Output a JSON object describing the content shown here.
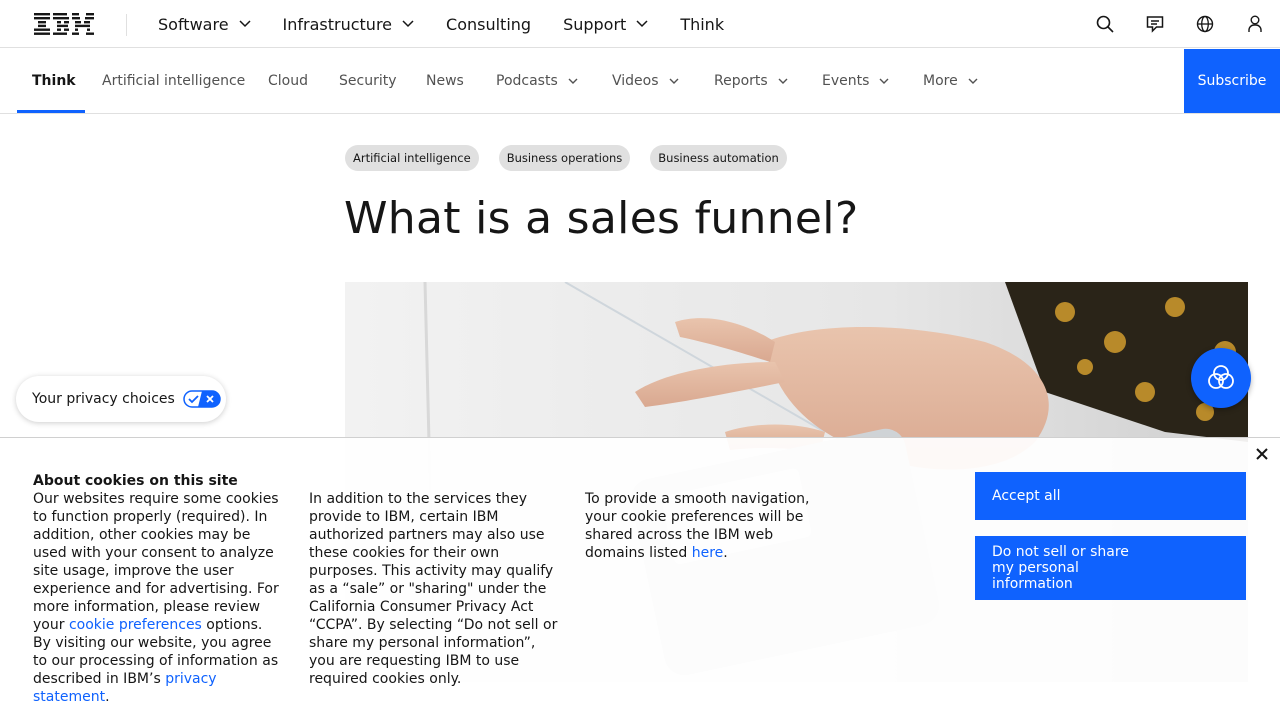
{
  "masthead": {
    "logo_text": "IBM",
    "nav": [
      {
        "label": "Software",
        "has_menu": true
      },
      {
        "label": "Infrastructure",
        "has_menu": true
      },
      {
        "label": "Consulting",
        "has_menu": false
      },
      {
        "label": "Support",
        "has_menu": true
      },
      {
        "label": "Think",
        "has_menu": false
      }
    ],
    "tools": [
      "search-icon",
      "chat-icon",
      "globe-icon",
      "user-icon"
    ]
  },
  "subnav": {
    "items": [
      {
        "label": "Think",
        "active": true
      },
      {
        "label": "Artificial intelligence"
      },
      {
        "label": "Cloud"
      },
      {
        "label": "Security"
      },
      {
        "label": "News"
      },
      {
        "label": "Podcasts",
        "has_menu": true
      },
      {
        "label": "Videos",
        "has_menu": true
      },
      {
        "label": "Reports",
        "has_menu": true
      },
      {
        "label": "Events",
        "has_menu": true
      },
      {
        "label": "More",
        "has_menu": true
      }
    ],
    "subscribe_label": "Subscribe"
  },
  "article": {
    "tags": [
      "Artificial intelligence",
      "Business operations",
      "Business automation"
    ],
    "title": "What is a sales funnel?"
  },
  "privacy_pill": {
    "label": "Your privacy choices"
  },
  "cookie_banner": {
    "heading": "About cookies on this site",
    "col1_text": "Our websites require some cookies to function properly (required). In addition, other cookies may be used with your consent to analyze site usage, improve the user experience and for advertising. For more information, please review your ",
    "col1_link1": "cookie preferences",
    "col1_text2": " options. By visiting our website, you agree to our processing of information as described in IBM’s ",
    "col1_link2": "privacy statement",
    "col1_text3": ".",
    "col2_text": "In addition to the services they provide to IBM, certain IBM authorized partners may also use these cookies for their own purposes. This activity may qualify as a “sale” or \"sharing\" under the California Consumer Privacy Act “CCPA”. By selecting “Do not sell or share my personal information”, you are requesting IBM to use required cookies only.",
    "col3_text": "To provide a smooth navigation, your cookie preferences will be shared across the IBM web domains listed ",
    "col3_link": "here",
    "col3_text2": ".",
    "accept_label": "Accept all",
    "notsell_label": "Do not sell or share my personal information"
  },
  "colors": {
    "accent": "#0f62fe",
    "text": "#161616",
    "tag_bg": "#e0e0e0"
  }
}
